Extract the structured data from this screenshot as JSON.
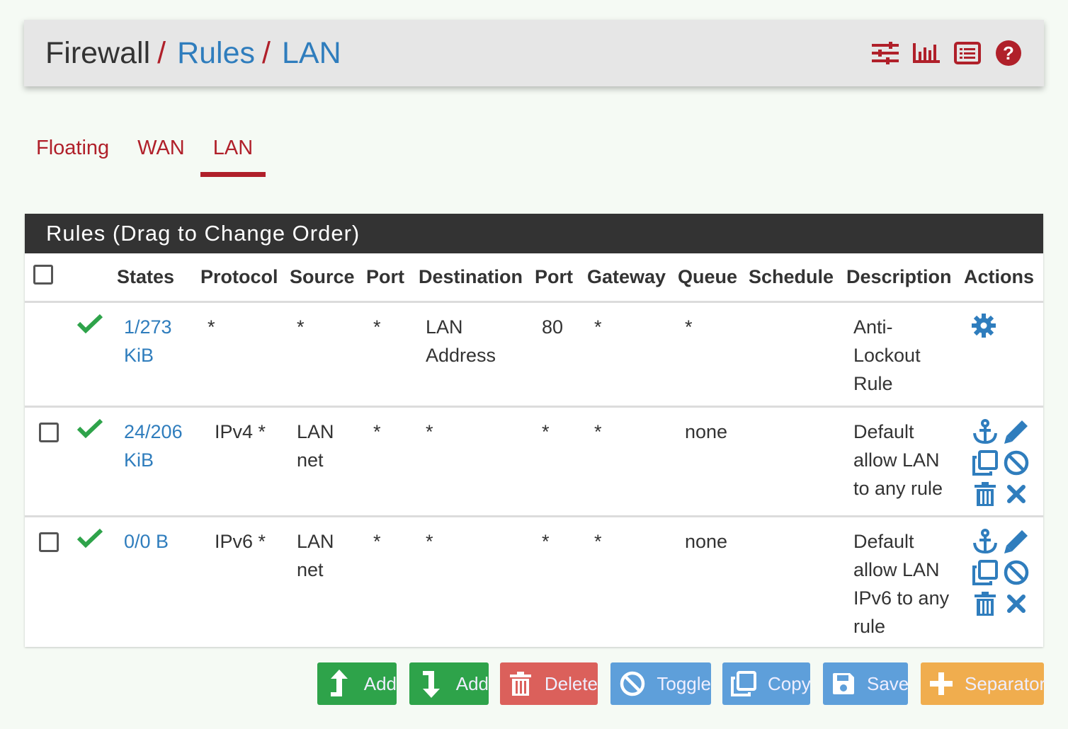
{
  "breadcrumb": {
    "root": "Firewall",
    "separator": "/",
    "link1": "Rules",
    "link2": "LAN"
  },
  "header_icons": [
    "sliders-icon",
    "bar-chart-icon",
    "list-icon",
    "help-icon"
  ],
  "tabs": [
    {
      "label": "Floating",
      "active": false
    },
    {
      "label": "WAN",
      "active": false
    },
    {
      "label": "LAN",
      "active": true
    }
  ],
  "panel": {
    "heading": "Rules (Drag to Change Order)",
    "columns": [
      "States",
      "Protocol",
      "Source",
      "Port",
      "Destination",
      "Port",
      "Gateway",
      "Queue",
      "Schedule",
      "Description",
      "Actions"
    ],
    "rows": [
      {
        "checkbox": false,
        "states_1": "1/273",
        "states_2": "KiB",
        "protocol": "*",
        "source_1": "*",
        "source_2": "",
        "src_port": "*",
        "destination_1": "LAN",
        "destination_2": "Address",
        "dst_port": "80",
        "gateway": "*",
        "queue": "*",
        "schedule": "",
        "description": [
          "Anti-",
          "Lockout",
          "Rule"
        ]
      },
      {
        "checkbox": true,
        "states_1": "24/206",
        "states_2": "KiB",
        "protocol": "IPv4 *",
        "source_1": "LAN",
        "source_2": "net",
        "src_port": "*",
        "destination_1": "*",
        "destination_2": "",
        "dst_port": "*",
        "gateway": "*",
        "queue": "none",
        "schedule": "",
        "description": [
          "Default",
          "allow LAN",
          "to any rule"
        ]
      },
      {
        "checkbox": true,
        "states_1": "0/0 B",
        "states_2": "",
        "protocol": "IPv6 *",
        "source_1": "LAN",
        "source_2": "net",
        "src_port": "*",
        "destination_1": "*",
        "destination_2": "",
        "dst_port": "*",
        "gateway": "*",
        "queue": "none",
        "schedule": "",
        "description": [
          "Default",
          "allow LAN",
          "IPv6 to any",
          "rule"
        ]
      }
    ]
  },
  "buttons": {
    "add_top": "Add",
    "add_bottom": "Add",
    "delete": "Delete",
    "toggle": "Toggle",
    "copy": "Copy",
    "save": "Save",
    "separator": "Separator"
  },
  "colors": {
    "accent_red": "#b0202a",
    "link_blue": "#2f7dbd",
    "success_green": "#2ea34a",
    "danger_red": "#d9534f",
    "info_blue": "#5e9fda",
    "warning_orange": "#f0ad4e"
  }
}
